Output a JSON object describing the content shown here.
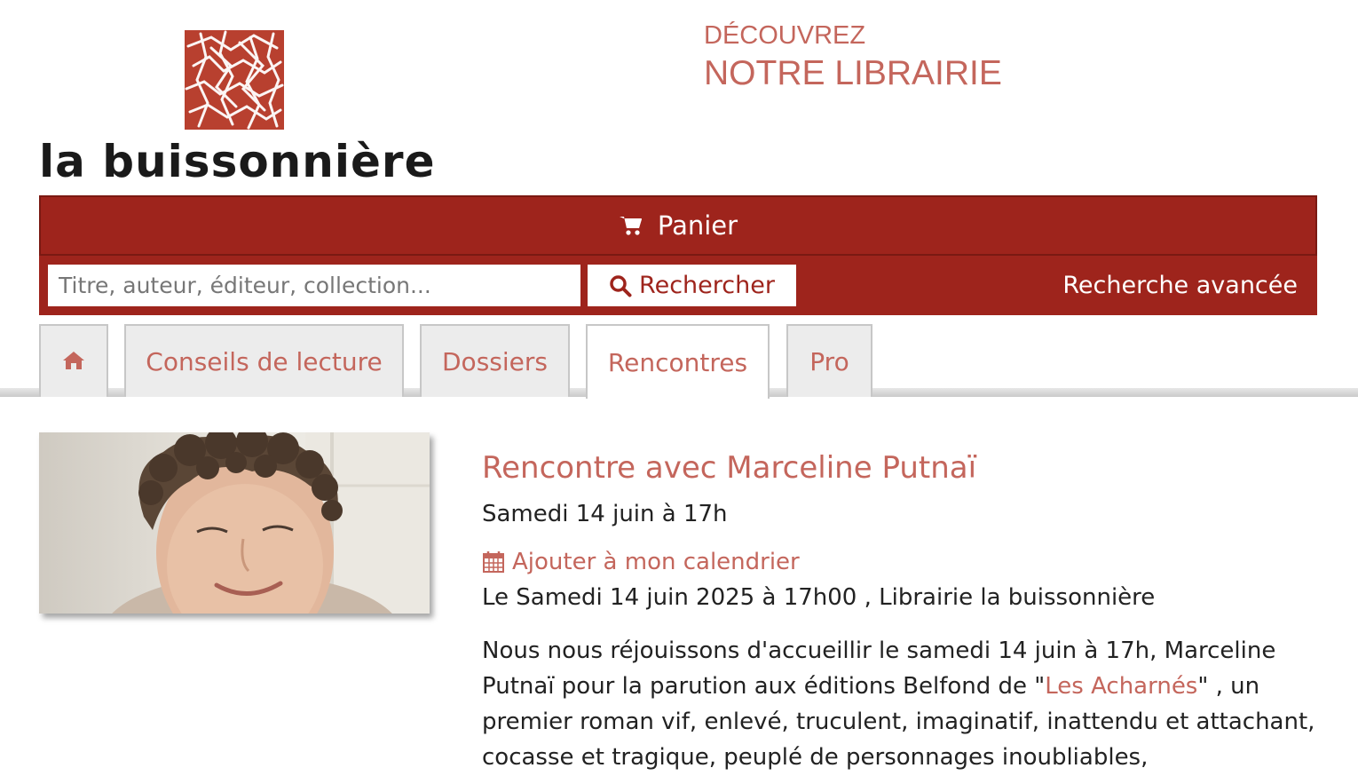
{
  "brand": {
    "name": "la buissonnière",
    "logo_icon": "bramble-square-logo",
    "brand_color": "#9e241c",
    "accent_color": "#c4665c"
  },
  "discover": {
    "small": "DÉCOUVREZ",
    "big": "NOTRE LIBRAIRIE"
  },
  "cart": {
    "label": "Panier",
    "icon": "shopping-cart-icon"
  },
  "search": {
    "placeholder": "Titre, auteur, éditeur, collection...",
    "value": "",
    "button_label": "Rechercher",
    "button_icon": "search-icon",
    "advanced_label": "Recherche avancée"
  },
  "nav": {
    "home_icon": "home-icon",
    "tabs": [
      {
        "label": "Conseils de lecture"
      },
      {
        "label": "Dossiers"
      },
      {
        "label": "Rencontres"
      },
      {
        "label": "Pro"
      }
    ],
    "active_tab": "Rencontres"
  },
  "event": {
    "title": "Rencontre avec Marceline Putnaï",
    "date": "Samedi 14 juin à 17h",
    "calendar_label": "Ajouter à mon calendrier",
    "calendar_icon": "calendar-icon",
    "place": "Le Samedi 14 juin 2025 à 17h00 , Librairie la buissonnière",
    "description_before": "Nous nous réjouissons d'accueillir le samedi 14 juin à 17h, Marceline Putnaï pour la parution aux éditions Belfond de \"",
    "description_link": "Les Acharnés",
    "description_after": "\" , un premier roman vif, enlevé, truculent, imaginatif, inattendu et attachant, cocasse et tragique, peuplé de personnages inoubliables,"
  }
}
